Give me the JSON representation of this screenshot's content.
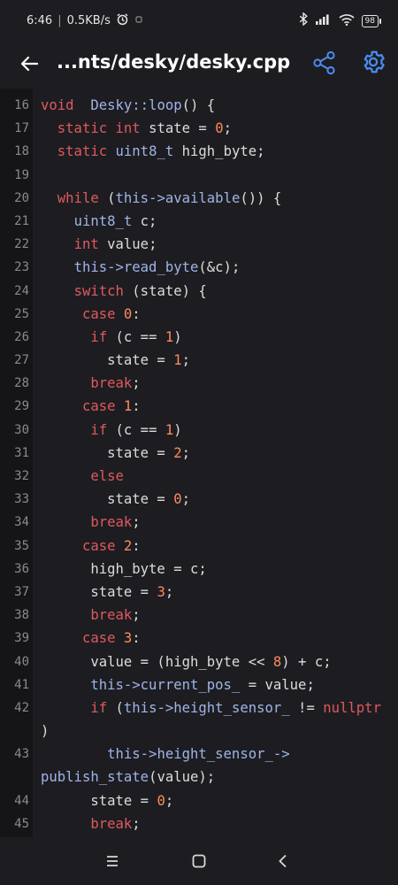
{
  "status": {
    "time": "6:46",
    "speed": "0.5KB/s",
    "battery": "98"
  },
  "appbar": {
    "title": "...nts/desky/desky.cpp"
  },
  "code_lines": [
    {
      "n": "16",
      "t": [
        [
          "kw",
          "void"
        ],
        [
          "",
          "  "
        ],
        [
          "ty",
          "Desky::loop"
        ],
        [
          "",
          "() {"
        ]
      ]
    },
    {
      "n": "17",
      "t": [
        [
          "",
          "  "
        ],
        [
          "kw",
          "static"
        ],
        [
          "",
          " "
        ],
        [
          "kw",
          "int"
        ],
        [
          "",
          " state = "
        ],
        [
          "num",
          "0"
        ],
        [
          "",
          ";"
        ]
      ]
    },
    {
      "n": "18",
      "t": [
        [
          "",
          "  "
        ],
        [
          "kw",
          "static"
        ],
        [
          "",
          " "
        ],
        [
          "ty",
          "uint8_t"
        ],
        [
          "",
          " high_byte;"
        ]
      ]
    },
    {
      "n": "19",
      "t": []
    },
    {
      "n": "20",
      "t": [
        [
          "",
          "  "
        ],
        [
          "kw",
          "while"
        ],
        [
          "",
          " ("
        ],
        [
          "fn",
          "this->available"
        ],
        [
          "",
          "()) {"
        ]
      ]
    },
    {
      "n": "21",
      "t": [
        [
          "",
          "    "
        ],
        [
          "ty",
          "uint8_t"
        ],
        [
          "",
          " c;"
        ]
      ]
    },
    {
      "n": "22",
      "t": [
        [
          "",
          "    "
        ],
        [
          "kw",
          "int"
        ],
        [
          "",
          " value;"
        ]
      ]
    },
    {
      "n": "23",
      "t": [
        [
          "",
          "    "
        ],
        [
          "fn",
          "this->read_byte"
        ],
        [
          "",
          "(&c);"
        ]
      ]
    },
    {
      "n": "24",
      "t": [
        [
          "",
          "    "
        ],
        [
          "kw",
          "switch"
        ],
        [
          "",
          " (state) {"
        ]
      ]
    },
    {
      "n": "25",
      "t": [
        [
          "",
          "     "
        ],
        [
          "kw",
          "case"
        ],
        [
          "",
          " "
        ],
        [
          "num",
          "0"
        ],
        [
          "",
          ":"
        ]
      ]
    },
    {
      "n": "26",
      "t": [
        [
          "",
          "      "
        ],
        [
          "kw",
          "if"
        ],
        [
          "",
          " (c == "
        ],
        [
          "num",
          "1"
        ],
        [
          "",
          ")"
        ]
      ]
    },
    {
      "n": "27",
      "t": [
        [
          "",
          "        state = "
        ],
        [
          "num",
          "1"
        ],
        [
          "",
          ";"
        ]
      ]
    },
    {
      "n": "28",
      "t": [
        [
          "",
          "      "
        ],
        [
          "kw",
          "break"
        ],
        [
          "",
          ";"
        ]
      ]
    },
    {
      "n": "29",
      "t": [
        [
          "",
          "     "
        ],
        [
          "kw",
          "case"
        ],
        [
          "",
          " "
        ],
        [
          "num",
          "1"
        ],
        [
          "",
          ":"
        ]
      ]
    },
    {
      "n": "30",
      "t": [
        [
          "",
          "      "
        ],
        [
          "kw",
          "if"
        ],
        [
          "",
          " (c == "
        ],
        [
          "num",
          "1"
        ],
        [
          "",
          ")"
        ]
      ]
    },
    {
      "n": "31",
      "t": [
        [
          "",
          "        state = "
        ],
        [
          "num",
          "2"
        ],
        [
          "",
          ";"
        ]
      ]
    },
    {
      "n": "32",
      "t": [
        [
          "",
          "      "
        ],
        [
          "kw",
          "else"
        ]
      ]
    },
    {
      "n": "33",
      "t": [
        [
          "",
          "        state = "
        ],
        [
          "num",
          "0"
        ],
        [
          "",
          ";"
        ]
      ]
    },
    {
      "n": "34",
      "t": [
        [
          "",
          "      "
        ],
        [
          "kw",
          "break"
        ],
        [
          "",
          ";"
        ]
      ]
    },
    {
      "n": "35",
      "t": [
        [
          "",
          "     "
        ],
        [
          "kw",
          "case"
        ],
        [
          "",
          " "
        ],
        [
          "num",
          "2"
        ],
        [
          "",
          ":"
        ]
      ]
    },
    {
      "n": "36",
      "t": [
        [
          "",
          "      high_byte = c;"
        ]
      ]
    },
    {
      "n": "37",
      "t": [
        [
          "",
          "      state = "
        ],
        [
          "num",
          "3"
        ],
        [
          "",
          ";"
        ]
      ]
    },
    {
      "n": "38",
      "t": [
        [
          "",
          "      "
        ],
        [
          "kw",
          "break"
        ],
        [
          "",
          ";"
        ]
      ]
    },
    {
      "n": "39",
      "t": [
        [
          "",
          "     "
        ],
        [
          "kw",
          "case"
        ],
        [
          "",
          " "
        ],
        [
          "num",
          "3"
        ],
        [
          "",
          ":"
        ]
      ]
    },
    {
      "n": "40",
      "t": [
        [
          "",
          "      value = (high_byte << "
        ],
        [
          "num",
          "8"
        ],
        [
          "",
          ") + c;"
        ]
      ]
    },
    {
      "n": "41",
      "t": [
        [
          "",
          "      "
        ],
        [
          "fn",
          "this->current_pos_"
        ],
        [
          "",
          " = value;"
        ]
      ]
    },
    {
      "n": "42",
      "t": [
        [
          "",
          "      "
        ],
        [
          "kw",
          "if"
        ],
        [
          "",
          " ("
        ],
        [
          "fn",
          "this->height_sensor_"
        ],
        [
          "",
          " != "
        ],
        [
          "kw",
          "nullptr"
        ]
      ]
    },
    {
      "n": "",
      "t": [
        [
          "",
          ")"
        ]
      ]
    },
    {
      "n": "43",
      "t": [
        [
          "",
          "        "
        ],
        [
          "fn",
          "this->height_sensor_->"
        ]
      ]
    },
    {
      "n": "",
      "t": [
        [
          "fn",
          "publish_state"
        ],
        [
          "",
          "(value);"
        ]
      ]
    },
    {
      "n": "44",
      "t": [
        [
          "",
          "      state = "
        ],
        [
          "num",
          "0"
        ],
        [
          "",
          ";"
        ]
      ]
    },
    {
      "n": "45",
      "t": [
        [
          "",
          "      "
        ],
        [
          "kw",
          "break"
        ],
        [
          "",
          ";"
        ]
      ]
    }
  ]
}
